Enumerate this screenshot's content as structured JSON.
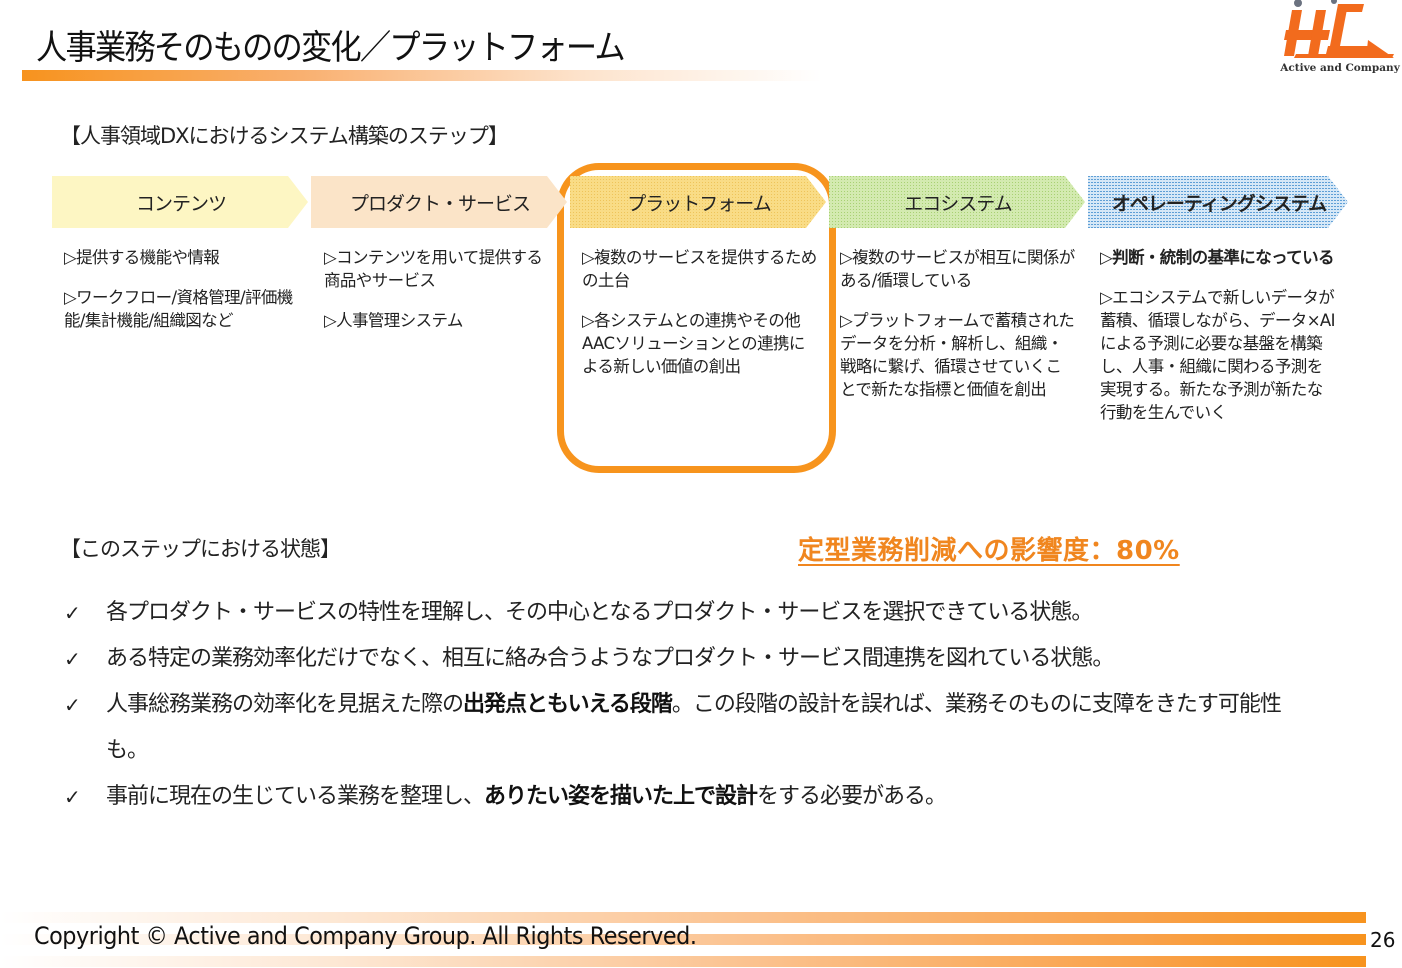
{
  "header": {
    "title": "人事業務そのものの変化／プラットフォーム",
    "logo_text": "Active and Company",
    "logo_color": "#f26b1d"
  },
  "steps_section": {
    "title": "【人事領域DXにおけるシステム構築のステップ】",
    "steps": [
      {
        "label": "コンテンツ",
        "color": "#fdf6c3",
        "bold": false
      },
      {
        "label": "プロダクト・サービス",
        "color": "#fbe4c8",
        "bold": false
      },
      {
        "label": "プラットフォーム",
        "color": "#f9d978",
        "bold": false
      },
      {
        "label": "エコシステム",
        "color": "#c9e3a1",
        "bold": false
      },
      {
        "label": "オペレーティングシステム",
        "color": "#9cc4e8",
        "bold": true
      }
    ],
    "highlighted_step": "プラットフォーム",
    "highlight_color": "#f7941d",
    "columns": [
      {
        "items": [
          {
            "text": "▷提供する機能や情報",
            "bold": false
          },
          {
            "text": "▷ワークフロー/資格管理/評価機能/集計機能/組織図など",
            "bold": false
          }
        ]
      },
      {
        "items": [
          {
            "text": "▷コンテンツを用いて提供する商品やサービス",
            "bold": false
          },
          {
            "text": "▷人事管理システム",
            "bold": false
          }
        ]
      },
      {
        "items": [
          {
            "text": "▷複数のサービスを提供するための土台",
            "bold": false
          },
          {
            "text": "▷各システムとの連携やその他AACソリューションとの連携による新しい価値の創出",
            "bold": false
          }
        ]
      },
      {
        "items": [
          {
            "text": "▷複数のサービスが相互に関係がある/循環している",
            "bold": false
          },
          {
            "text": "▷プラットフォームで蓄積されたデータを分析・解析し、組織・戦略に繋げ、循環させていくことで新たな指標と価値を創出",
            "bold": false
          }
        ]
      },
      {
        "items": [
          {
            "text": "▷判断・統制の基準になっている",
            "bold": true
          },
          {
            "text": "▷エコシステムで新しいデータが蓄積、循環しながら、データ×AIによる予測に必要な基盤を構築し、人事・組織に関わる予測を実現する。新たな予測が新たな行動を生んでいく",
            "bold": false
          }
        ]
      }
    ]
  },
  "state_section": {
    "title": "【このステップにおける状態】",
    "impact_label": "定型業務削減への影響度：80%",
    "impact_value_percent": 80,
    "impact_color": "#f0861f",
    "check_mark": "✓",
    "items": [
      {
        "segments": [
          {
            "text": "各プロダクト・サービスの特性を理解し、その中心となるプロダクト・サービスを選択できている状態。",
            "bold": false
          }
        ]
      },
      {
        "segments": [
          {
            "text": "ある特定の業務効率化だけでなく、相互に絡み合うようなプロダクト・サービス間連携を図れている状態。",
            "bold": false
          }
        ]
      },
      {
        "segments": [
          {
            "text": "人事総務業務の効率化を見据えた際の",
            "bold": false
          },
          {
            "text": "出発点ともいえる段階",
            "bold": true
          },
          {
            "text": "。この段階の設計を誤れば、業務そのものに支障をきたす可能性も。",
            "bold": false
          }
        ]
      },
      {
        "segments": [
          {
            "text": "事前に現在の生じている業務を整理し、",
            "bold": false
          },
          {
            "text": "ありたい姿を描いた上で設計",
            "bold": true
          },
          {
            "text": "をする必要がある。",
            "bold": false
          }
        ]
      }
    ]
  },
  "footer": {
    "copyright": "Copyright © Active and Company Group. All Rights Reserved.",
    "page_number": "26"
  }
}
